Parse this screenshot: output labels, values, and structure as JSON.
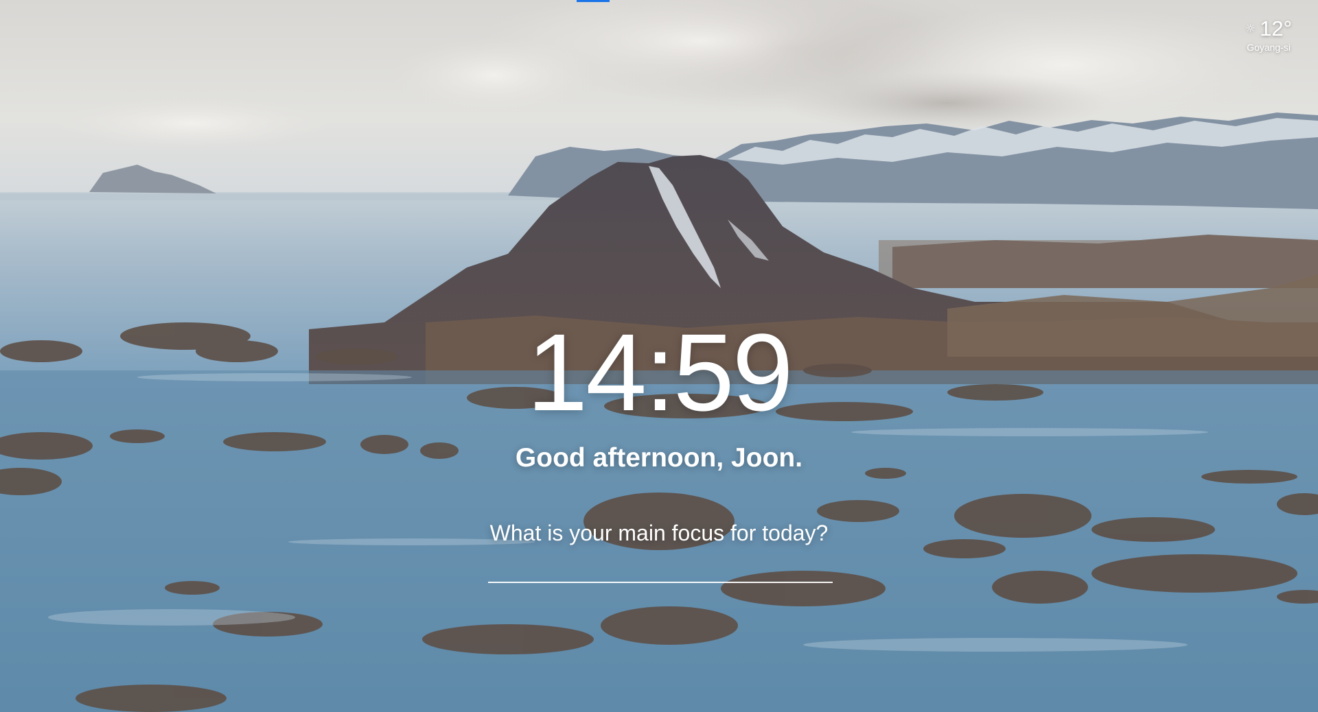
{
  "weather": {
    "icon": "sun-icon",
    "temperature": "12°",
    "location": "Goyang-si"
  },
  "clock": {
    "time": "14:59"
  },
  "greeting": {
    "text": "Good afternoon, Joon."
  },
  "focus": {
    "question": "What is your main focus for today?",
    "input_value": ""
  },
  "colors": {
    "text": "#ffffff",
    "loading_bar": "#1a73e8"
  }
}
